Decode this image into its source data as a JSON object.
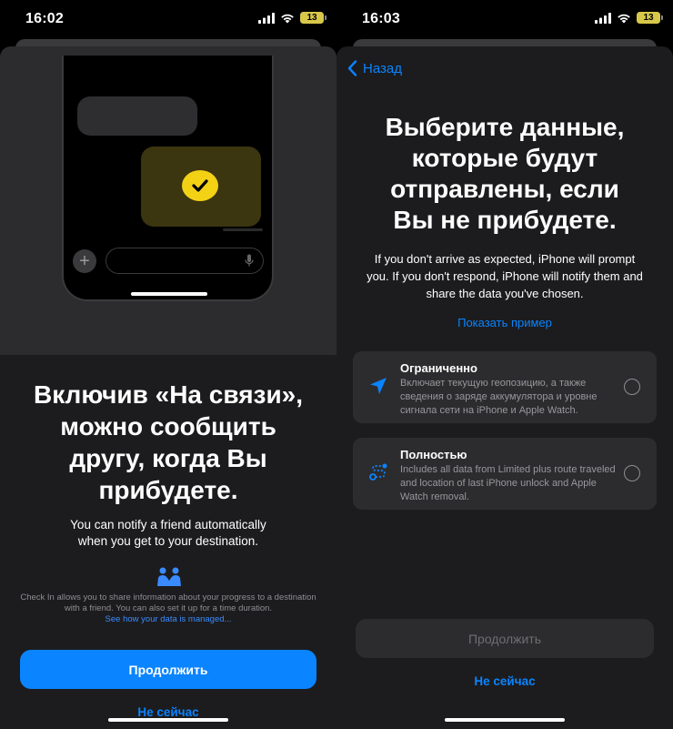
{
  "colors": {
    "accent": "#0a84ff",
    "check_yellow": "#f3d215",
    "battery": "#d8c84a"
  },
  "left": {
    "status": {
      "time": "16:02",
      "battery": "13"
    },
    "title": "Включив «На связи», можно сообщить другу, когда Вы прибудете.",
    "subtitle": "You can notify a friend automatically when you get to your destination.",
    "info_text": "Check In allows you to share information about your progress to a destination with a friend. You can also set it up for a time duration.",
    "info_link": "See how your data is managed...",
    "continue_label": "Продолжить",
    "not_now_label": "Не сейчас"
  },
  "right": {
    "status": {
      "time": "16:03",
      "battery": "13"
    },
    "back_label": "Назад",
    "title": "Выберите данные, которые будут отправлены, если Вы не прибудете.",
    "subtitle": "If you don't arrive as expected, iPhone will prompt you. If you don't respond, iPhone will notify them and share the data you've chosen.",
    "show_example_label": "Показать пример",
    "options": [
      {
        "title": "Ограниченно",
        "description": "Включает текущую геопозицию, а также сведения о заряде аккумулятора и уровне сигнала сети на iPhone и Apple Watch.",
        "icon": "location-arrow-icon"
      },
      {
        "title": "Полностью",
        "description": "Includes all data from Limited plus route traveled and location of last iPhone unlock and Apple Watch removal.",
        "icon": "route-icon"
      }
    ],
    "continue_label": "Продолжить",
    "not_now_label": "Не сейчас"
  }
}
